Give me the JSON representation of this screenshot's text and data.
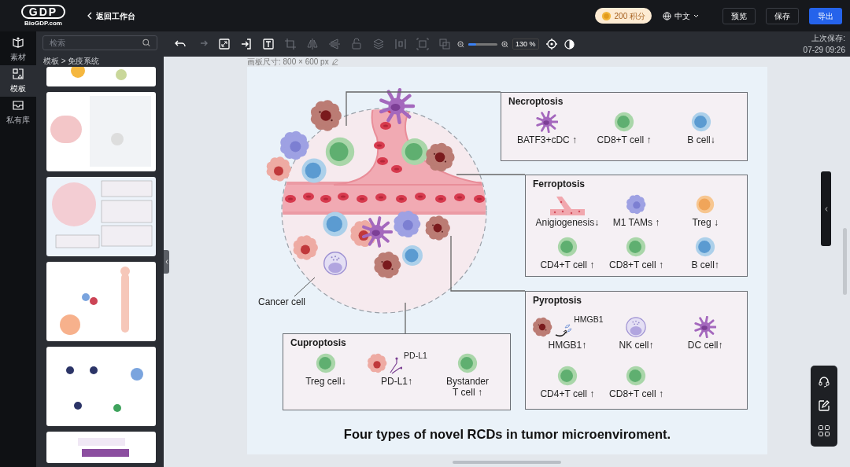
{
  "header": {
    "logo_mark": "GDP",
    "logo_text": "BioGDP.com",
    "back_label": "返回工作台",
    "points": "200 积分",
    "language": "中文",
    "buttons": [
      {
        "label": "预览",
        "kind": "outline"
      },
      {
        "label": "保存",
        "kind": "outline"
      },
      {
        "label": "导出",
        "kind": "primary"
      }
    ]
  },
  "rail": [
    {
      "label": "素材",
      "kind": "materials",
      "selected": false
    },
    {
      "label": "模板",
      "kind": "templates",
      "selected": true
    },
    {
      "label": "私有库",
      "kind": "library",
      "selected": false
    }
  ],
  "panel": {
    "search_placeholder": "检索",
    "breadcrumb": "模板 > 免疫系统"
  },
  "toolbar": {
    "tools": [
      {
        "kind": "undo",
        "disabled": false
      },
      {
        "kind": "redo",
        "disabled": true
      },
      {
        "kind": "fit",
        "disabled": false
      },
      {
        "kind": "import",
        "disabled": false
      },
      {
        "kind": "text",
        "disabled": false
      },
      {
        "kind": "crop",
        "disabled": true
      },
      {
        "kind": "flip_h",
        "disabled": true
      },
      {
        "kind": "flip_v",
        "disabled": true
      },
      {
        "kind": "lock",
        "disabled": true
      },
      {
        "kind": "layers",
        "disabled": true
      },
      {
        "kind": "distribute",
        "disabled": true
      },
      {
        "kind": "frame",
        "disabled": true
      },
      {
        "kind": "group",
        "disabled": true
      }
    ],
    "zoom": {
      "level": 0.28,
      "reading": "130 %"
    },
    "last_saved_label": "上次保存:",
    "last_saved_time": "07-29 09:26"
  },
  "canvas": {
    "size_label": "画板尺寸: 800 × 600 px",
    "figure": {
      "callout": "Cancer cell",
      "title": "Four types of novel RCDs in tumor microenviroment.",
      "panels": [
        {
          "title": "Necroptosis",
          "items": [
            {
              "kind": "dendritic",
              "label": "BATF3+cDC ↑"
            },
            {
              "kind": "t_cell",
              "label": "CD8+T cell ↑"
            },
            {
              "kind": "b_cell",
              "label": "B cell↓"
            }
          ]
        },
        {
          "title": "Ferroptosis",
          "items": [
            {
              "kind": "vessel",
              "label": "Anigiogenesis↓"
            },
            {
              "kind": "macrophage",
              "label": "M1 TAMs ↑"
            },
            {
              "kind": "treg",
              "label": "Treg ↓"
            },
            {
              "kind": "t_cell",
              "label": "CD4+T cell ↑"
            },
            {
              "kind": "t_cell",
              "label": "CD8+T cell ↑"
            },
            {
              "kind": "b_cell",
              "label": "B cell↑"
            }
          ]
        },
        {
          "title": "Cuproptosis",
          "items": [
            {
              "kind": "t_cell",
              "label": "Treg cell↓"
            },
            {
              "kind": "cancer",
              "label": "PD-L1↑",
              "annotation": "PD-L1"
            },
            {
              "kind": "t_cell",
              "label": "Bystander T cell ↑"
            }
          ]
        },
        {
          "title": "Pyroptosis",
          "items": [
            {
              "kind": "pyroptotic",
              "label": "HMGB1↑",
              "annotation": "HMGB1"
            },
            {
              "kind": "nk",
              "label": "NK cell↑"
            },
            {
              "kind": "dendritic",
              "label": "DC cell↑"
            },
            {
              "kind": "t_cell",
              "label": "CD4+T cell ↑"
            },
            {
              "kind": "t_cell",
              "label": "CD8+T cell ↑"
            }
          ]
        }
      ]
    }
  }
}
